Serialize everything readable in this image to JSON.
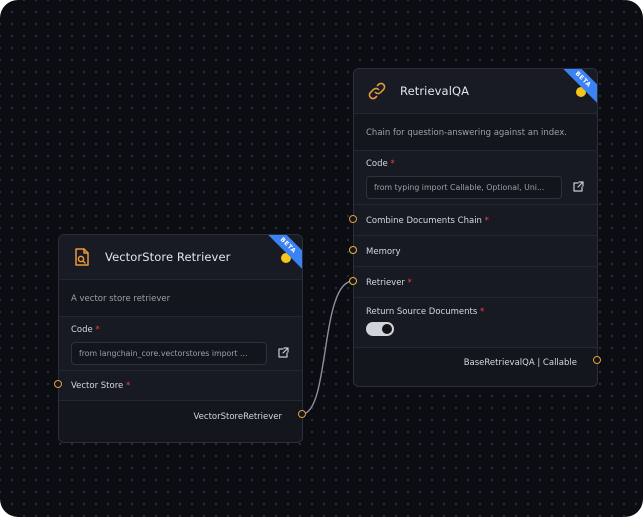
{
  "colors": {
    "canvas_bg": "#0b0d12",
    "node_bg": "#13161d",
    "accent_orange": "#e59a3b",
    "status_yellow": "#f5c518",
    "beta_blue": "#3b82f6",
    "required_red": "#ef4444"
  },
  "retriever_node": {
    "icon": "file-search-icon",
    "title": "VectorStore Retriever",
    "badge": "BETA",
    "description": "A vector store retriever",
    "code_label": "Code",
    "required_mark": "*",
    "code_value": "from langchain_core.vectorstores import ...",
    "input_label": "Vector Store",
    "output_label": "VectorStoreRetriever"
  },
  "qa_node": {
    "icon": "link-icon",
    "title": "RetrievalQA",
    "badge": "BETA",
    "description": "Chain for question-answering against an index.",
    "code_label": "Code",
    "required_mark": "*",
    "code_value": "from typing import Callable, Optional, Uni...",
    "fields": {
      "combine": "Combine Documents Chain",
      "memory": "Memory",
      "retriever": "Retriever",
      "return_source": "Return Source Documents"
    },
    "return_source_enabled": true,
    "output_label": "BaseRetrievalQA | Callable"
  }
}
